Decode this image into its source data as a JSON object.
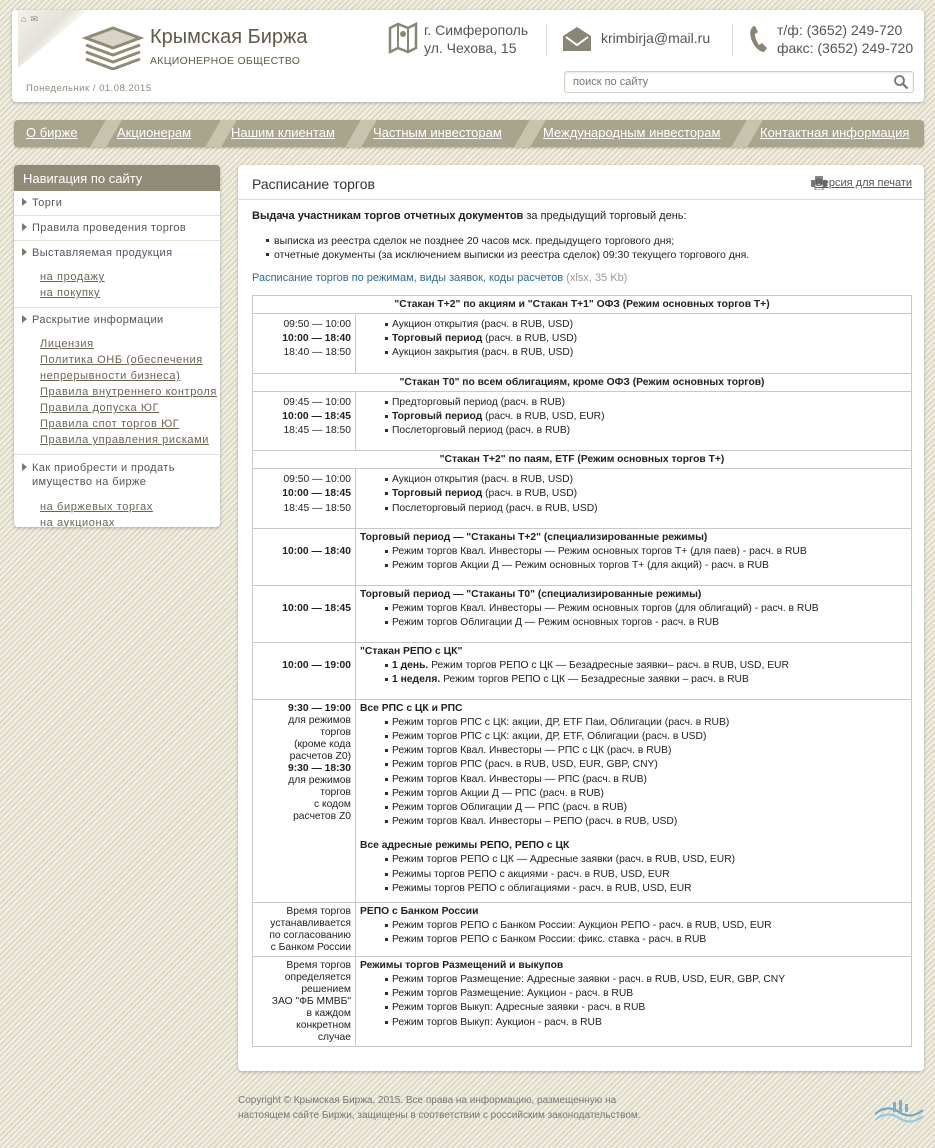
{
  "header": {
    "brand": "Крымская Биржа",
    "brand_sub": "АКЦИОНЕРНОЕ ОБЩЕСТВО",
    "date": "Понедельник  /  01.08.2015",
    "city": "г. Симферополь",
    "street": "ул. Чехова, 15",
    "email": "krimbirja@mail.ru",
    "phone": "т/ф: (3652) 249-720",
    "fax": "факс: (3652) 249-720",
    "search_placeholder": "поиск по сайту"
  },
  "nav": [
    "О бирже",
    "Акционерам",
    "Нашим клиентам",
    "Частным инвесторам",
    "Международным инвесторам",
    "Контактная информация"
  ],
  "sidebar": {
    "title": "Навигация по сайту",
    "s1": "Торги",
    "s2": "Правила проведения торгов",
    "s3": "Выставляемая продукция",
    "s3a": "на продажу",
    "s3b": "на покупку",
    "s4": "Раскрытие информации",
    "s4a": "Лицензия",
    "s4b": "Политика ОНБ (обеспечения",
    "s4b2": "непрерывности бизнеса)",
    "s4c": "Правила внутреннего контроля",
    "s4d": "Правила допуска  ЮГ",
    "s4e": "Правила спот торгов  ЮГ",
    "s4f": "Правила управления рисками",
    "s5": "Как приобрести и продать",
    "s5b": "имущество на бирже",
    "s5a1": "на биржевых торгах",
    "s5a2": "на аукционах"
  },
  "content": {
    "title": "Расписание торгов",
    "print": "Версия для печати",
    "lead_bold": "Выдача участникам торгов отчетных документов",
    "lead_rest": " за предыдущий торговый день:",
    "b1": "выписка из реестра сделок не позднее 20 часов мск. предыдущего торгового дня;",
    "b2": "отчетные документы (за исключением выписки из реестра сделок) 09:30 текущего торгового дня.",
    "link": "Расписание торгов по режимам, виды заявок, коды расчетов",
    "link_meta": "(xlsx, 35 Kb)"
  },
  "table": {
    "h1": "\"Стакан Т+2\" по акциям и \"Стакан Т+1\" ОФЗ (Режим основных торгов Т+)",
    "r1t": [
      "09:50 — 10:00",
      "10:00 — 18:40",
      "18:40 — 18:50"
    ],
    "r1d": [
      [
        "",
        "Аукцион открытия (расч. в RUB, USD)"
      ],
      [
        "Торговый период",
        "(расч. в RUB, USD)"
      ],
      [
        "",
        "Аукцион закрытия (расч. в RUB, USD)"
      ]
    ],
    "h2": "\"Стакан Т0\" по всем облигациям, кроме ОФЗ (Режим основных торгов)",
    "r2t": [
      "09:45 — 10:00",
      "10:00 — 18:45",
      "18:45 — 18:50"
    ],
    "r2d": [
      [
        "",
        "Предторговый период (расч. в RUB)"
      ],
      [
        "Торговый период",
        "(расч. в RUB, USD, EUR)"
      ],
      [
        "",
        "Послеторговый период (расч. в RUB)"
      ]
    ],
    "h3": "\"Стакан Т+2\" по паям, ETF (Режим основных торгов Т+)",
    "r3t": [
      "09:50 — 10:00",
      "10:00 — 18:45",
      "18:45 — 18:50"
    ],
    "r3d": [
      [
        "",
        "Аукцион открытия (расч. в RUB, USD)"
      ],
      [
        "Торговый период",
        "(расч. в RUB, USD)"
      ],
      [
        "",
        "Послеторговый период (расч. в RUB, USD)"
      ]
    ],
    "r4t": "10:00 — 18:40",
    "r4h": "Торговый период — \"Стаканы Т+2\" (специализированные режимы)",
    "r4d": [
      "Режим торгов Квал. Инвесторы — Режим основных торгов Т+ (для паев) - расч. в RUB",
      "Режим торгов Акции Д — Режим основных торгов Т+ (для акций) - расч. в RUB"
    ],
    "r5t": "10:00 — 18:45",
    "r5h": "Торговый период — \"Стаканы Т0\"  (специализированные режимы)",
    "r5d": [
      "Режим торгов Квал. Инвесторы — Режим основных торгов (для облигаций) - расч. в RUB",
      "Режим торгов Облигации Д — Режим основных торгов - расч. в RUB"
    ],
    "r6t": "10:00 — 19:00",
    "r6h": "\"Стакан РЕПО с ЦК\"",
    "r6d": [
      [
        "1 день.",
        "Режим торгов РЕПО с ЦК — Безадресные заявки– расч. в RUB, USD, EUR"
      ],
      [
        "1 неделя.",
        "Режим торгов РЕПО с ЦК — Безадресные заявки – расч. в RUB"
      ]
    ],
    "r7t1": "9:30 — 19:00",
    "r7t1n": [
      "для режимов",
      "торгов",
      "(кроме кода",
      "расчетов Z0)"
    ],
    "r7t2": "9:30 — 18:30",
    "r7t2n": [
      "для режимов",
      "торгов",
      "с кодом",
      "расчетов Z0"
    ],
    "r7h1": "Все РПС с ЦК и РПС",
    "r7d1": [
      "Режим торгов РПС с ЦК: акции, ДР, ETF Паи, Облигации (расч. в RUB)",
      "Режим торгов РПС с ЦК: акции, ДР, ETF, Облигации (расч. в USD)",
      "Режим торгов Квал. Инвесторы — РПС с ЦК (расч. в RUB)",
      "Режим торгов РПС (расч. в RUB, USD, EUR, GBP, CNY)",
      "Режим торгов Квал. Инвесторы — РПС (расч. в RUB)",
      "Режим торгов Акции Д — РПС (расч. в RUB)",
      "Режим торгов Облигации Д — РПС (расч. в RUB)",
      "Режим торгов Квал. Инвесторы – РЕПО (расч. в RUB, USD)"
    ],
    "r7h2": "Все адресные режимы РЕПО, РЕПО с ЦК",
    "r7d2": [
      "Режим торгов РЕПО с ЦК — Адресные заявки (расч. в RUB, USD, EUR)",
      "Режимы торгов РЕПО с акциями - расч. в RUB, USD, EUR",
      "Режимы торгов РЕПО с облигациями - расч. в RUB, USD, EUR"
    ],
    "r8t": [
      "Время торгов",
      "устанавливается",
      "по согласованию",
      "с Банком России"
    ],
    "r8h": "РЕПО с Банком России",
    "r8d": [
      "Режим торгов РЕПО с Банком России: Аукцион РЕПО - расч. в RUB, USD, EUR",
      "Режим торгов РЕПО с Банком России: фикс. ставка - расч. в RUB"
    ],
    "r9t": [
      "Время торгов",
      "определяется",
      "решением",
      "ЗАО \"ФБ ММВБ\"",
      "в каждом",
      "конкретном",
      "случае"
    ],
    "r9h": "Режимы торгов Размещений и выкупов",
    "r9d": [
      "Режим торгов Размещение: Адресные заявки - расч. в RUB, USD, EUR, GBP, CNY",
      "Режим торгов Размещение: Аукцион - расч. в RUB",
      "Режим торгов Выкуп: Адресные заявки - расч. в RUB",
      "Режим торгов Выкуп: Аукцион - расч. в RUB"
    ]
  },
  "footer": {
    "l1": "Copyright © Крымская Биржа, 2015. Все права на информацию, размещенную на",
    "l2": "настоящем сайте Биржи, защищены в соответствии с российским законодательством."
  },
  "colors": {
    "nav": "#a9a58d",
    "sidebar_head": "#8f8b76",
    "link": "#2a6a9a",
    "brand": "#5e5a48"
  }
}
